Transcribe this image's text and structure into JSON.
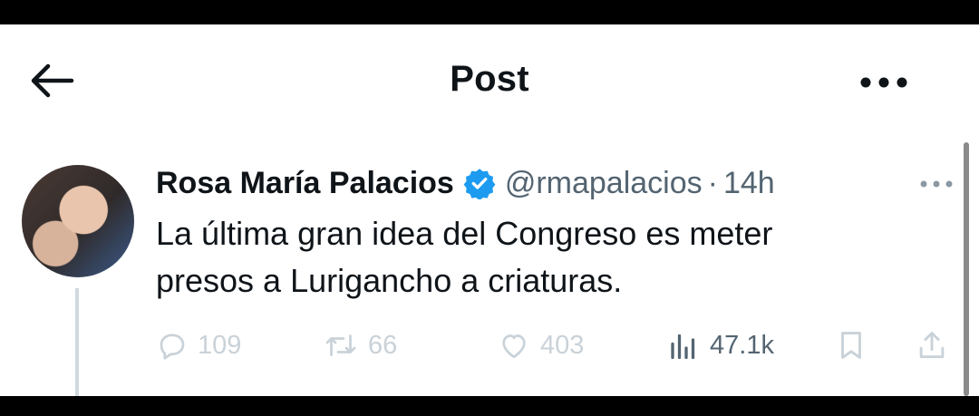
{
  "header": {
    "title": "Post",
    "back_icon": "arrow-left-icon",
    "more_icon": "more-horizontal-icon"
  },
  "tweet": {
    "author": {
      "name": "Rosa María Palacios",
      "handle": "@rmapalacios",
      "verified": true,
      "verified_color": "#1d9bf0"
    },
    "separator": "·",
    "time": "14h",
    "text_line1": "La última gran idea del Congreso es meter",
    "text_line2": "presos a Lurigancho a criaturas.",
    "actions": {
      "replies": "109",
      "retweets": "66",
      "likes": "403",
      "views": "47.1k"
    }
  },
  "colors": {
    "muted": "#536471",
    "faded": "#c9d2d8",
    "text": "#0f1419",
    "thread_line": "#cfd9de"
  }
}
